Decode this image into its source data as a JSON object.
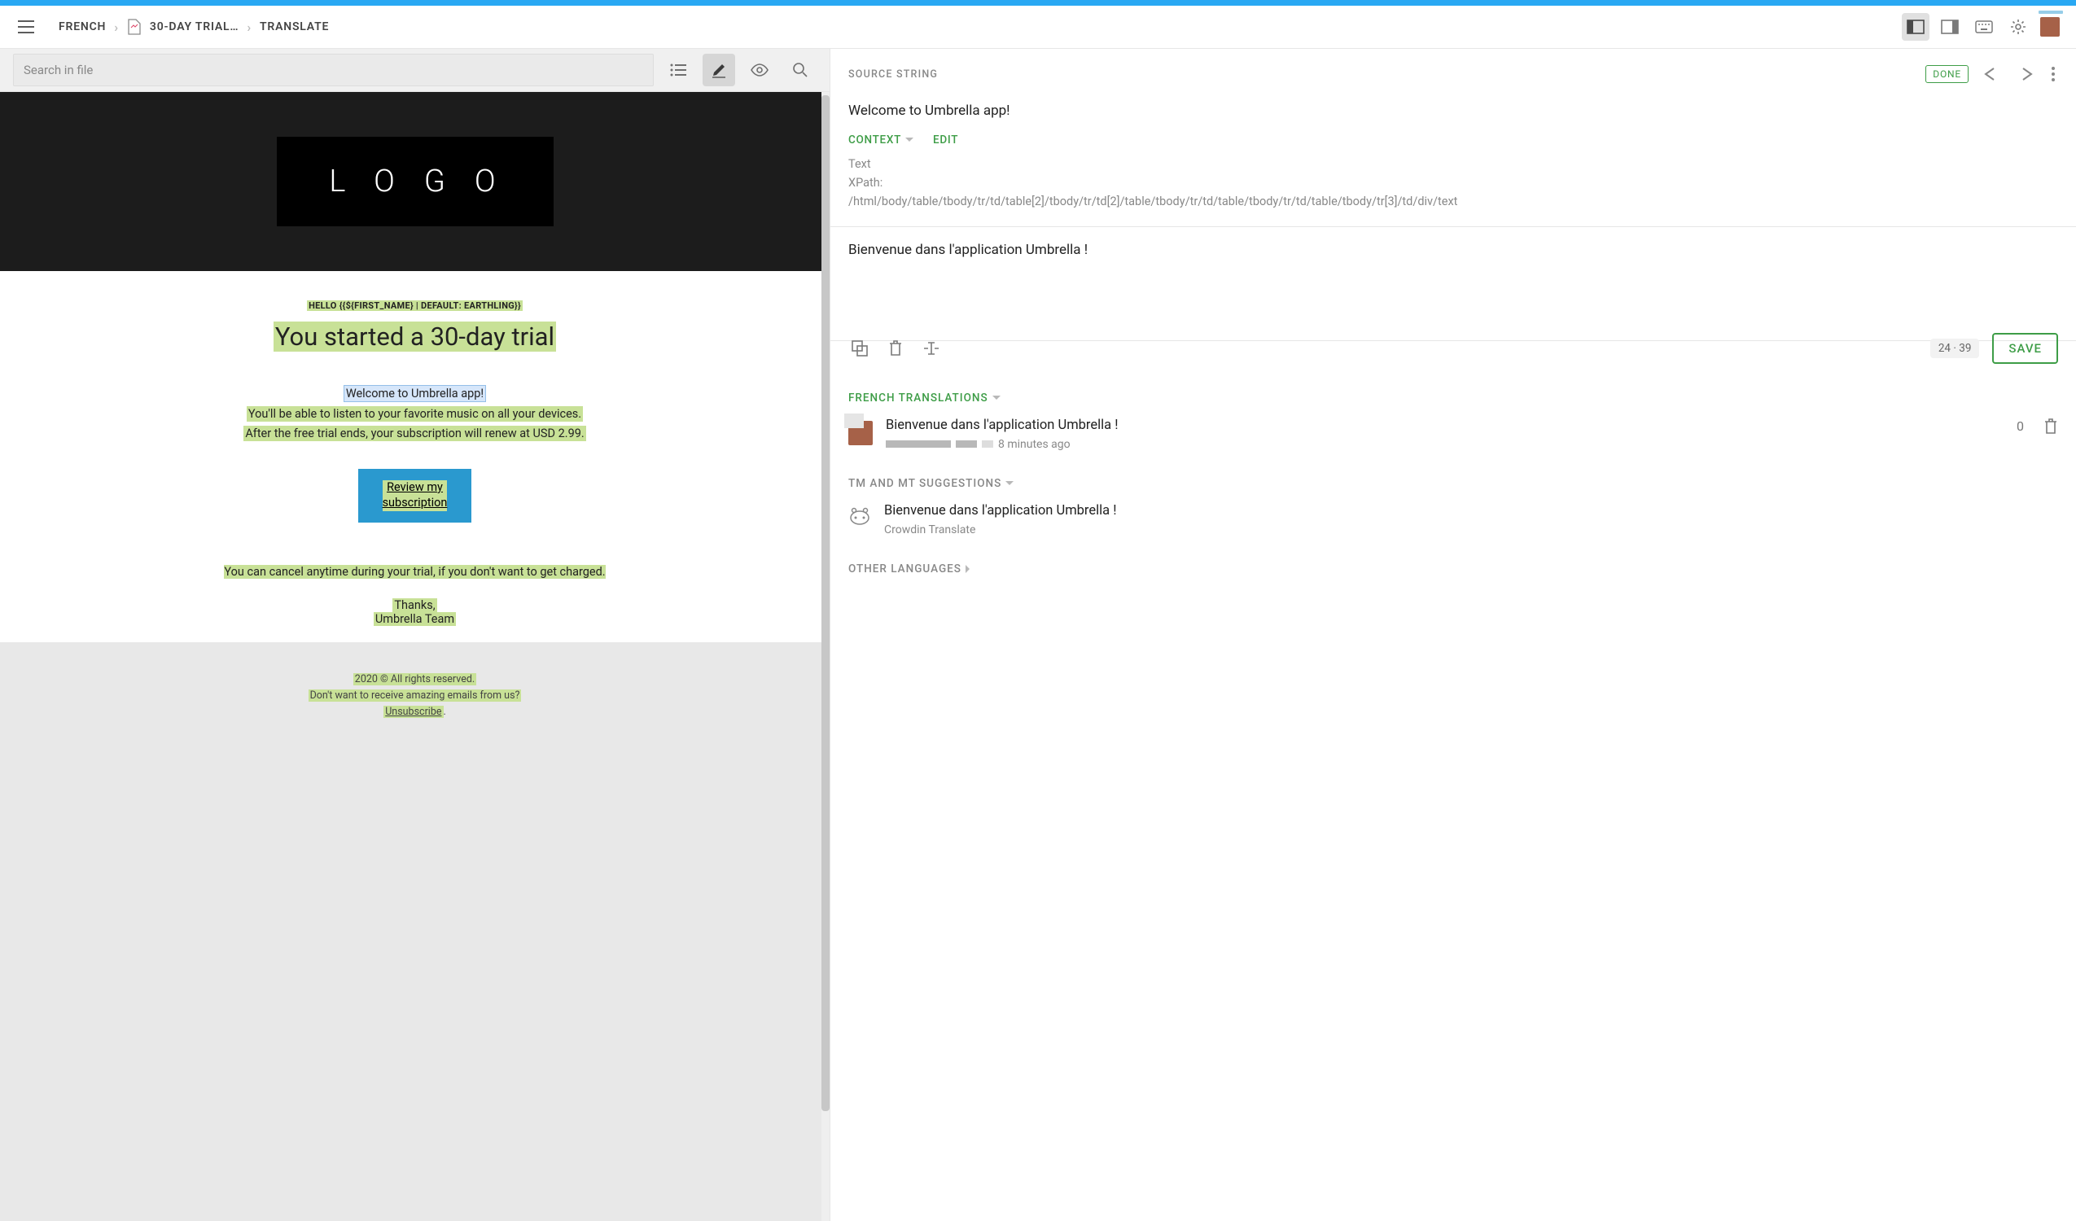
{
  "header": {
    "breadcrumb_lang": "French",
    "breadcrumb_file": "30-Day Trial…",
    "breadcrumb_page": "Translate"
  },
  "toolbar": {
    "search_placeholder": "Search in file"
  },
  "preview": {
    "logo_text": "LOGO",
    "greeting": "HELLO {{${FIRST_NAME} | DEFAULT: EARTHLING}}",
    "headline": "You started a 30-day trial",
    "welcome": "Welcome to Umbrella app!",
    "line2": "You'll be able to listen to your favorite music on all your devices.",
    "line3": "After the free trial ends, your subscription will renew at USD 2.99.",
    "cta_line1": "Review my",
    "cta_line2": "subscription",
    "cancel": "You can cancel anytime during your trial, if you don't want to get charged.",
    "thanks": "Thanks,",
    "team": "Umbrella Team",
    "copyright": "2020 © All rights reserved.",
    "unsub_q": "Don't want to receive amazing emails from us?",
    "unsub": "Unsubscribe"
  },
  "right": {
    "source_label": "SOURCE STRING",
    "done": "DONE",
    "source_text": "Welcome to Umbrella app!",
    "context_label": "CONTEXT",
    "edit_label": "EDIT",
    "ctx_type": "Text",
    "ctx_xpath_label": "XPath:",
    "ctx_xpath": "/html/body/table/tbody/tr/td/table[2]/tbody/tr/td[2]/table/tbody/tr/td/table/tbody/tr/td/table/tbody/tr[3]/td/div/text",
    "translation_value": "Bienvenue dans l'application Umbrella !",
    "char_count": "24  ·  39",
    "save_label": "SAVE",
    "translations_label": "FRENCH TRANSLATIONS",
    "translation1_text": "Bienvenue dans l'application Umbrella !",
    "translation1_time": "8 minutes ago",
    "translation1_votes": "0",
    "tm_label": "TM AND MT SUGGESTIONS",
    "mt_text": "Bienvenue dans l'application Umbrella !",
    "mt_source": "Crowdin Translate",
    "other_label": "OTHER LANGUAGES"
  }
}
